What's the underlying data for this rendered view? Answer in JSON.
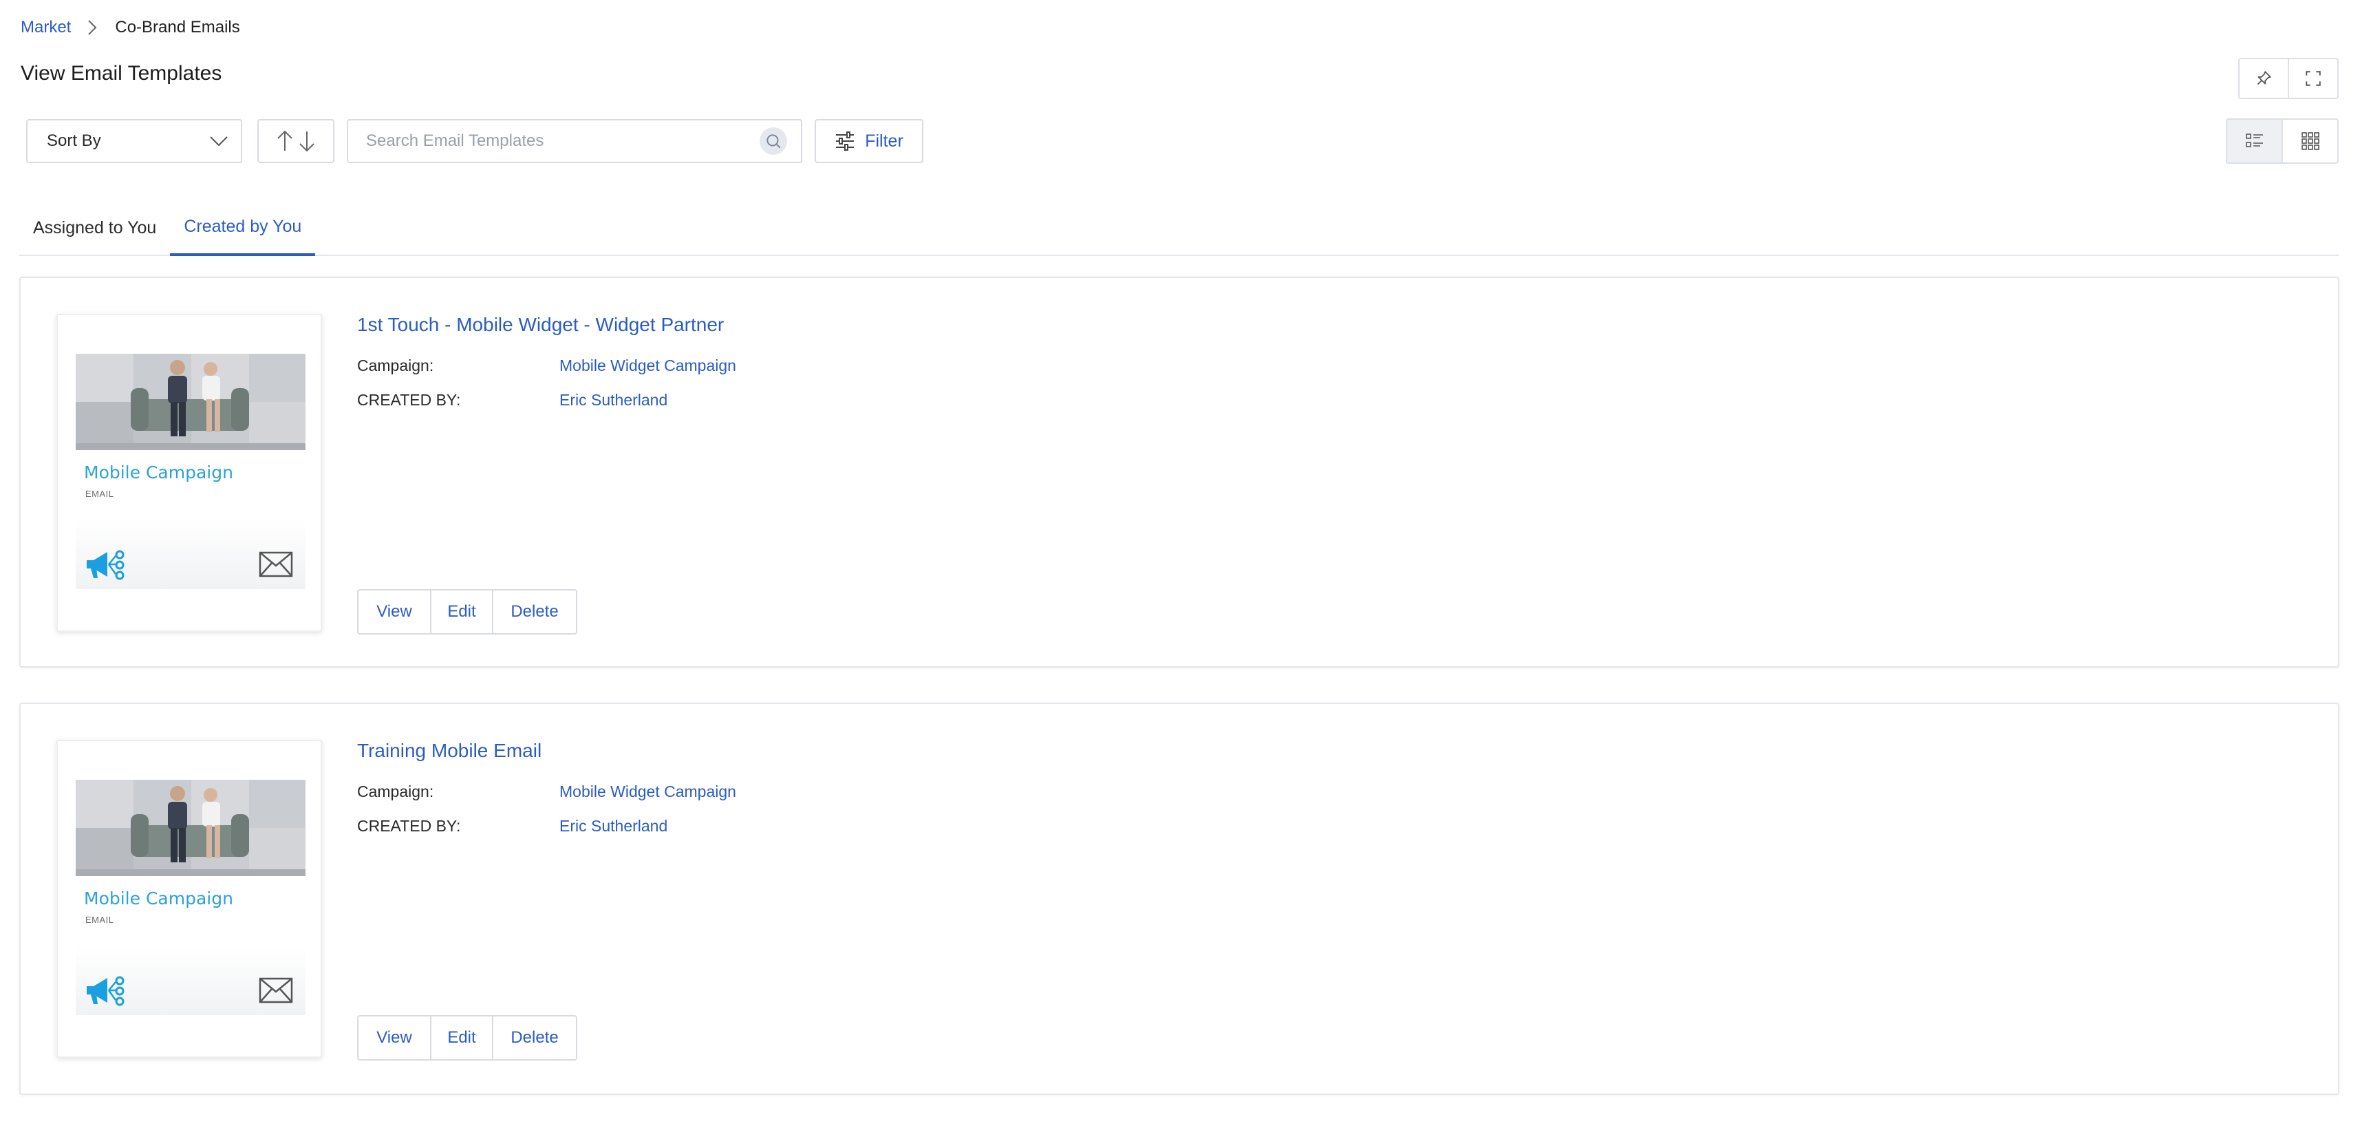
{
  "breadcrumb": {
    "parent": "Market",
    "current": "Co-Brand Emails"
  },
  "page": {
    "title": "View Email Templates"
  },
  "toolbar": {
    "sort_label": "Sort By",
    "search_placeholder": "Search Email Templates",
    "filter_label": "Filter"
  },
  "tabs": [
    {
      "label": "Assigned to You",
      "active": false
    },
    {
      "label": "Created by You",
      "active": true
    }
  ],
  "labels": {
    "campaign": "Campaign:",
    "created_by": "CREATED BY:"
  },
  "actions": {
    "view": "View",
    "edit": "Edit",
    "delete": "Delete"
  },
  "templates": [
    {
      "title": "1st Touch - Mobile Widget - Widget Partner",
      "campaign": "Mobile Widget Campaign",
      "created_by": "Eric Sutherland",
      "thumb_title": "Mobile Campaign",
      "thumb_sub": "EMAIL"
    },
    {
      "title": "Training Mobile Email",
      "campaign": "Mobile Widget Campaign",
      "created_by": "Eric Sutherland",
      "thumb_title": "Mobile Campaign",
      "thumb_sub": "EMAIL"
    }
  ],
  "icons": {
    "pin": "pin-icon",
    "fullscreen": "fullscreen-icon",
    "chevron": "chevron-down-icon",
    "sort": "sort-arrows-icon",
    "search": "search-icon",
    "filter": "filter-sliders-icon",
    "list_view": "list-view-icon",
    "grid_view": "grid-view-icon",
    "megaphone": "megaphone-icon",
    "mail": "envelope-icon"
  },
  "colors": {
    "accent": "#2a5cc6",
    "thumb_title": "#2aa3d8",
    "border": "#d8dbe0"
  }
}
